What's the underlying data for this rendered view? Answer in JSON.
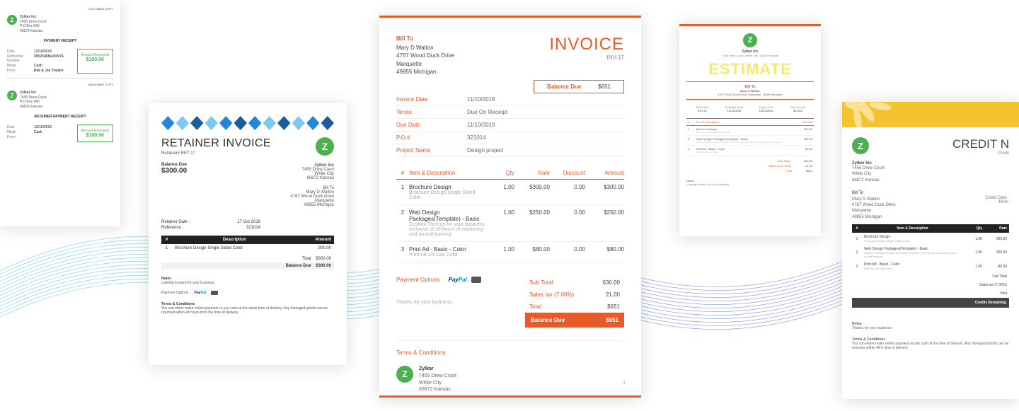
{
  "receipt": {
    "customer_copy": "CUSTOMER COPY",
    "merchant_copy": "MERCHANT COPY",
    "company": "Zylker Inc",
    "addr1": "7455 Drew Court",
    "addr2": "P.O Box 940",
    "addr3": "66872 Kansas",
    "title": "PAYMENT RECEIPT",
    "title2": "RETAINER PAYMENT RECEIPT",
    "date_k": "Date",
    "date_v": "12/10/2016",
    "ref_k": "Reference Number",
    "ref_v": "00526d08e200974",
    "mode_k": "Mode",
    "mode_v": "Cash",
    "from_k": "From",
    "from_v": "Rob & Joe Traders",
    "amt_lbl": "Amount Received",
    "amt_val": "$100.00"
  },
  "retainer": {
    "title": "RETAINER INVOICE",
    "ret_no": "Retainer# RET-17",
    "bal_k": "Balance Due",
    "bal_v": "$300.00",
    "company": "Zylker Inc",
    "co_addr": [
      "7455 Drew Court",
      "White City",
      "66872 Kansas"
    ],
    "bill_to_lbl": "Bill To",
    "bill_to": [
      "Mary D Walton",
      "4767 Wood Duck Drive",
      "Marquette",
      "49855 Michigan"
    ],
    "rd_k": "Retainer Date :",
    "rd_v": "17 Oct 2019",
    "ref_k": "Reference :",
    "ref_v": "321014",
    "th": [
      "#",
      "Description",
      "Amount"
    ],
    "row": {
      "n": "1",
      "desc": "Brochure Design Single Sided Color",
      "amt": "300.00"
    },
    "total_k": "Total",
    "total_v": "$300.00",
    "bal2_k": "Balance Due",
    "bal2_v": "$300.00",
    "notes_h": "Notes",
    "notes_t": "Looking forward for your business.",
    "pay_lbl": "Payment Options :",
    "tc_h": "Terms & Conditions",
    "tc_t": "You can either make online payment or pay cash at the same time of delivery. Any damaged goods can be returned within 48 hours from the time of delivery."
  },
  "invoice": {
    "bill_to_lbl": "Bill To",
    "bill_to": [
      "Mary D Walton",
      "4767 Wood Duck Drive",
      "Marquette",
      "49855 Michigan"
    ],
    "title": "INVOICE",
    "num": "INV-17",
    "bal_lbl": "Balance Due",
    "bal_val": "$651",
    "meta": [
      {
        "k": "Invoice Date",
        "v": "11/10/2019"
      },
      {
        "k": "Terms",
        "v": "Due On Receipt"
      },
      {
        "k": "Due Date",
        "v": "11/10/2019"
      },
      {
        "k": "P.O.#",
        "v": "321014"
      },
      {
        "k": "Project Name",
        "v": "Design project"
      }
    ],
    "th": {
      "n": "#",
      "item": "Item & Description",
      "qty": "Qty",
      "rate": "Rate",
      "disc": "Discount",
      "amt": "Amount"
    },
    "items": [
      {
        "n": "1",
        "t": "Brochure Design",
        "s": "Brochure Design Single Sided Color",
        "qty": "1.00",
        "rate": "$300.00",
        "disc": "0.00",
        "amt": "$300.00"
      },
      {
        "n": "2",
        "t": "Web Design Packages(Template) - Basic",
        "s": "Custom Themes for your business. Inclusive of 10 hours of marketing and annual training",
        "qty": "1.00",
        "rate": "$250.00",
        "disc": "0.00",
        "amt": "$250.00"
      },
      {
        "n": "3",
        "t": "Print Ad - Basic - Color",
        "s": "Print Ad 1/8 size Color",
        "qty": "1.00",
        "rate": "$80.00",
        "disc": "0.00",
        "amt": "$80.00"
      }
    ],
    "pay_lbl": "Payment Options",
    "thanks": "Thanks for your business.",
    "sums": [
      {
        "k": "Sub Total",
        "v": "630.00"
      },
      {
        "k": "Sales tax (7.00%)",
        "v": "21.00"
      },
      {
        "k": "Total",
        "v": "$651"
      }
    ],
    "due_k": "Balance Due",
    "due_v": "$651",
    "tc_lbl": "Terms & Conditions",
    "footer_co": "Zylkar",
    "footer_addr": [
      "7455 Drew Court",
      "White City",
      "66872 Kansas"
    ],
    "page": "1"
  },
  "estimate": {
    "co": "Zylker Inc",
    "co_addr": "7455 Drew Court, White City , 66872 Kansas",
    "title": "ESTIMATE",
    "bill_lbl": "Bill To",
    "bill1": "Mary D Walton",
    "bill2": "4767 Wood Duck Drive, Marquette, 49855 Michigan",
    "meta": [
      {
        "k": "Estimate#",
        "v": "EST-17"
      },
      {
        "k": "Estimate Date",
        "v": "12/11/2019"
      },
      {
        "k": "Expiry Date",
        "v": "13/12/2019"
      },
      {
        "k": "Reference#",
        "v": "321014"
      }
    ],
    "th": {
      "n": "#",
      "item": "Item & Description",
      "amt": "Amount"
    },
    "items": [
      {
        "n": "1",
        "t": "Brochure Design",
        "s": "Brochure Design Single Sided Color",
        "amt": "300.00"
      },
      {
        "n": "2",
        "t": "Web Design Packages(Template) - Basic",
        "s": "Custom Themes for your business. Inclusive of 10 hours of marketing and annual training",
        "amt": "250.00"
      },
      {
        "n": "3",
        "t": "Print Ad - Basic - Color",
        "s": "Print Ad 1/8 size Color",
        "amt": "80.00"
      }
    ],
    "sums": [
      {
        "k": "Sub Total",
        "v": "630.00"
      },
      {
        "k": "Sales tax (7.00%)",
        "v": "21.00"
      },
      {
        "k": "Total",
        "v": "$651"
      }
    ],
    "notes_h": "Notes",
    "notes_t": "Looking forward for your business"
  },
  "credit": {
    "title": "CREDIT N",
    "num": "Credit",
    "co": "Zylker Inc",
    "co_addr": [
      "7455 Drew Court",
      "White City",
      "66872 Kansas"
    ],
    "bill_lbl": "Bill To",
    "bill": [
      "Mary D Walton",
      "4767 Wood Duck Drive",
      "Marquette",
      "49855 Michigan"
    ],
    "cd_k": "Credit Date :",
    "ref_k": "Ref#:",
    "th": {
      "n": "#",
      "item": "Item & Description",
      "qty": "Qty",
      "rate": "Rate"
    },
    "items": [
      {
        "n": "1",
        "t": "Brochure Design",
        "s": "Brochure Design Single Sided Color",
        "qty": "1.00",
        "rate": "300.00"
      },
      {
        "n": "2",
        "t": "Web Design Packages(Template) - Basic",
        "s": "Custom Themes for your business. Inclusive of 10 hours of marketing and annual training",
        "qty": "1.00",
        "rate": "250.00"
      },
      {
        "n": "3",
        "t": "Print Ad - Basic - Color",
        "s": "Print Ad 1/8 size Color",
        "qty": "1.00",
        "rate": "80.00"
      }
    ],
    "sums": [
      "Sub Total",
      "Sales tax (7.00%)",
      "Total",
      "Credits Remaining"
    ],
    "notes_h": "Notes",
    "notes_t": "Thanks for your business.",
    "tc_h": "Terms & Conditions",
    "tc_t": "You can either make online payment or pay cash at the time of delivery. Any damaged goods can be returned within 48 h time of delivery."
  }
}
